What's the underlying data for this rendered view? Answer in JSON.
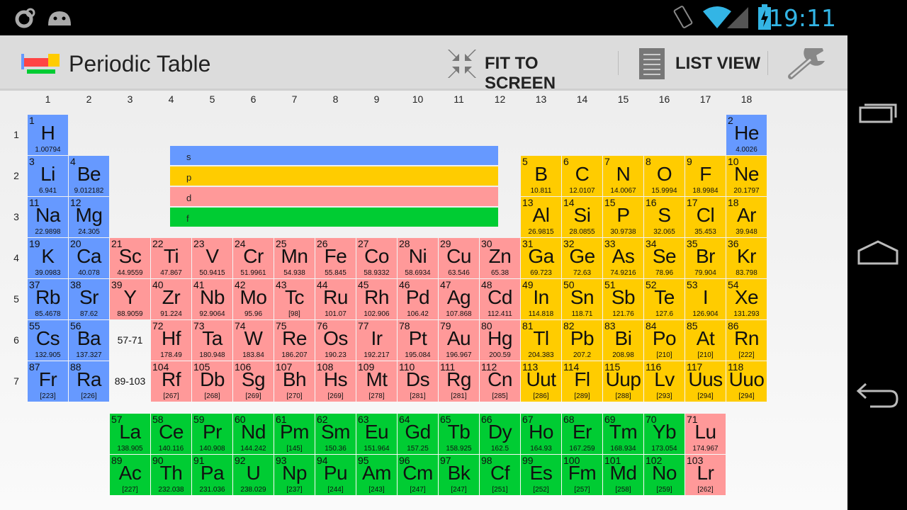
{
  "status_bar": {
    "time": "19:11",
    "icons": [
      "sync-icon",
      "android-icon",
      "vibrate-icon",
      "wifi-icon",
      "signal-icon",
      "battery-charging-icon"
    ]
  },
  "action_bar": {
    "title": "Periodic Table",
    "fit_label": "FIT TO SCREEN",
    "list_label": "LIST VIEW"
  },
  "colors": {
    "s": "#6699ff",
    "p": "#ffcc00",
    "d": "#ff9999",
    "f": "#00cc33"
  },
  "legend": [
    {
      "block": "s",
      "label": "s"
    },
    {
      "block": "p",
      "label": "p"
    },
    {
      "block": "d",
      "label": "d"
    },
    {
      "block": "f",
      "label": "f"
    }
  ],
  "groups": [
    "1",
    "2",
    "3",
    "4",
    "5",
    "6",
    "7",
    "8",
    "9",
    "10",
    "11",
    "12",
    "13",
    "14",
    "15",
    "16",
    "17",
    "18"
  ],
  "periods": [
    "1",
    "2",
    "3",
    "4",
    "5",
    "6",
    "7"
  ],
  "ranges": [
    "57-71",
    "89-103"
  ],
  "element_columns": [
    "number",
    "symbol",
    "weight",
    "block",
    "group",
    "period"
  ],
  "elements": [
    [
      1,
      "H",
      "1.00794",
      "s",
      1,
      1
    ],
    [
      2,
      "He",
      "4.0026",
      "s",
      18,
      1
    ],
    [
      3,
      "Li",
      "6.941",
      "s",
      1,
      2
    ],
    [
      4,
      "Be",
      "9.012182",
      "s",
      2,
      2
    ],
    [
      5,
      "B",
      "10.811",
      "p",
      13,
      2
    ],
    [
      6,
      "C",
      "12.0107",
      "p",
      14,
      2
    ],
    [
      7,
      "N",
      "14.0067",
      "p",
      15,
      2
    ],
    [
      8,
      "O",
      "15.9994",
      "p",
      16,
      2
    ],
    [
      9,
      "F",
      "18.9984",
      "p",
      17,
      2
    ],
    [
      10,
      "Ne",
      "20.1797",
      "p",
      18,
      2
    ],
    [
      11,
      "Na",
      "22.9898",
      "s",
      1,
      3
    ],
    [
      12,
      "Mg",
      "24.305",
      "s",
      2,
      3
    ],
    [
      13,
      "Al",
      "26.9815",
      "p",
      13,
      3
    ],
    [
      14,
      "Si",
      "28.0855",
      "p",
      14,
      3
    ],
    [
      15,
      "P",
      "30.9738",
      "p",
      15,
      3
    ],
    [
      16,
      "S",
      "32.065",
      "p",
      16,
      3
    ],
    [
      17,
      "Cl",
      "35.453",
      "p",
      17,
      3
    ],
    [
      18,
      "Ar",
      "39.948",
      "p",
      18,
      3
    ],
    [
      19,
      "K",
      "39.0983",
      "s",
      1,
      4
    ],
    [
      20,
      "Ca",
      "40.078",
      "s",
      2,
      4
    ],
    [
      21,
      "Sc",
      "44.9559",
      "d",
      3,
      4
    ],
    [
      22,
      "Ti",
      "47.867",
      "d",
      4,
      4
    ],
    [
      23,
      "V",
      "50.9415",
      "d",
      5,
      4
    ],
    [
      24,
      "Cr",
      "51.9961",
      "d",
      6,
      4
    ],
    [
      25,
      "Mn",
      "54.938",
      "d",
      7,
      4
    ],
    [
      26,
      "Fe",
      "55.845",
      "d",
      8,
      4
    ],
    [
      27,
      "Co",
      "58.9332",
      "d",
      9,
      4
    ],
    [
      28,
      "Ni",
      "58.6934",
      "d",
      10,
      4
    ],
    [
      29,
      "Cu",
      "63.546",
      "d",
      11,
      4
    ],
    [
      30,
      "Zn",
      "65.38",
      "d",
      12,
      4
    ],
    [
      31,
      "Ga",
      "69.723",
      "p",
      13,
      4
    ],
    [
      32,
      "Ge",
      "72.63",
      "p",
      14,
      4
    ],
    [
      33,
      "As",
      "74.9216",
      "p",
      15,
      4
    ],
    [
      34,
      "Se",
      "78.96",
      "p",
      16,
      4
    ],
    [
      35,
      "Br",
      "79.904",
      "p",
      17,
      4
    ],
    [
      36,
      "Kr",
      "83.798",
      "p",
      18,
      4
    ],
    [
      37,
      "Rb",
      "85.4678",
      "s",
      1,
      5
    ],
    [
      38,
      "Sr",
      "87.62",
      "s",
      2,
      5
    ],
    [
      39,
      "Y",
      "88.9059",
      "d",
      3,
      5
    ],
    [
      40,
      "Zr",
      "91.224",
      "d",
      4,
      5
    ],
    [
      41,
      "Nb",
      "92.9064",
      "d",
      5,
      5
    ],
    [
      42,
      "Mo",
      "95.96",
      "d",
      6,
      5
    ],
    [
      43,
      "Tc",
      "[98]",
      "d",
      7,
      5
    ],
    [
      44,
      "Ru",
      "101.07",
      "d",
      8,
      5
    ],
    [
      45,
      "Rh",
      "102.906",
      "d",
      9,
      5
    ],
    [
      46,
      "Pd",
      "106.42",
      "d",
      10,
      5
    ],
    [
      47,
      "Ag",
      "107.868",
      "d",
      11,
      5
    ],
    [
      48,
      "Cd",
      "112.411",
      "d",
      12,
      5
    ],
    [
      49,
      "In",
      "114.818",
      "p",
      13,
      5
    ],
    [
      50,
      "Sn",
      "118.71",
      "p",
      14,
      5
    ],
    [
      51,
      "Sb",
      "121.76",
      "p",
      15,
      5
    ],
    [
      52,
      "Te",
      "127.6",
      "p",
      16,
      5
    ],
    [
      53,
      "I",
      "126.904",
      "p",
      17,
      5
    ],
    [
      54,
      "Xe",
      "131.293",
      "p",
      18,
      5
    ],
    [
      55,
      "Cs",
      "132.905",
      "s",
      1,
      6
    ],
    [
      56,
      "Ba",
      "137.327",
      "s",
      2,
      6
    ],
    [
      72,
      "Hf",
      "178.49",
      "d",
      4,
      6
    ],
    [
      73,
      "Ta",
      "180.948",
      "d",
      5,
      6
    ],
    [
      74,
      "W",
      "183.84",
      "d",
      6,
      6
    ],
    [
      75,
      "Re",
      "186.207",
      "d",
      7,
      6
    ],
    [
      76,
      "Os",
      "190.23",
      "d",
      8,
      6
    ],
    [
      77,
      "Ir",
      "192.217",
      "d",
      9,
      6
    ],
    [
      78,
      "Pt",
      "195.084",
      "d",
      10,
      6
    ],
    [
      79,
      "Au",
      "196.967",
      "d",
      11,
      6
    ],
    [
      80,
      "Hg",
      "200.59",
      "d",
      12,
      6
    ],
    [
      81,
      "Tl",
      "204.383",
      "p",
      13,
      6
    ],
    [
      82,
      "Pb",
      "207.2",
      "p",
      14,
      6
    ],
    [
      83,
      "Bi",
      "208.98",
      "p",
      15,
      6
    ],
    [
      84,
      "Po",
      "[210]",
      "p",
      16,
      6
    ],
    [
      85,
      "At",
      "[210]",
      "p",
      17,
      6
    ],
    [
      86,
      "Rn",
      "[222]",
      "p",
      18,
      6
    ],
    [
      87,
      "Fr",
      "[223]",
      "s",
      1,
      7
    ],
    [
      88,
      "Ra",
      "[226]",
      "s",
      2,
      7
    ],
    [
      104,
      "Rf",
      "[267]",
      "d",
      4,
      7
    ],
    [
      105,
      "Db",
      "[268]",
      "d",
      5,
      7
    ],
    [
      106,
      "Sg",
      "[269]",
      "d",
      6,
      7
    ],
    [
      107,
      "Bh",
      "[270]",
      "d",
      7,
      7
    ],
    [
      108,
      "Hs",
      "[269]",
      "d",
      8,
      7
    ],
    [
      109,
      "Mt",
      "[278]",
      "d",
      9,
      7
    ],
    [
      110,
      "Ds",
      "[281]",
      "d",
      10,
      7
    ],
    [
      111,
      "Rg",
      "[281]",
      "d",
      11,
      7
    ],
    [
      112,
      "Cn",
      "[285]",
      "d",
      12,
      7
    ],
    [
      113,
      "Uut",
      "[286]",
      "p",
      13,
      7
    ],
    [
      114,
      "Fl",
      "[289]",
      "p",
      14,
      7
    ],
    [
      115,
      "Uup",
      "[288]",
      "p",
      15,
      7
    ],
    [
      116,
      "Lv",
      "[293]",
      "p",
      16,
      7
    ],
    [
      117,
      "Uus",
      "[294]",
      "p",
      17,
      7
    ],
    [
      118,
      "Uuo",
      "[294]",
      "p",
      18,
      7
    ]
  ],
  "lanthanides": [
    [
      57,
      "La",
      "138.905",
      "f"
    ],
    [
      58,
      "Ce",
      "140.116",
      "f"
    ],
    [
      59,
      "Pr",
      "140.908",
      "f"
    ],
    [
      60,
      "Nd",
      "144.242",
      "f"
    ],
    [
      61,
      "Pm",
      "[145]",
      "f"
    ],
    [
      62,
      "Sm",
      "150.36",
      "f"
    ],
    [
      63,
      "Eu",
      "151.964",
      "f"
    ],
    [
      64,
      "Gd",
      "157.25",
      "f"
    ],
    [
      65,
      "Tb",
      "158.925",
      "f"
    ],
    [
      66,
      "Dy",
      "162.5",
      "f"
    ],
    [
      67,
      "Ho",
      "164.93",
      "f"
    ],
    [
      68,
      "Er",
      "167.259",
      "f"
    ],
    [
      69,
      "Tm",
      "168.934",
      "f"
    ],
    [
      70,
      "Yb",
      "173.054",
      "f"
    ],
    [
      71,
      "Lu",
      "174.967",
      "d"
    ]
  ],
  "actinides": [
    [
      89,
      "Ac",
      "[227]",
      "f"
    ],
    [
      90,
      "Th",
      "232.038",
      "f"
    ],
    [
      91,
      "Pa",
      "231.036",
      "f"
    ],
    [
      92,
      "U",
      "238.029",
      "f"
    ],
    [
      93,
      "Np",
      "[237]",
      "f"
    ],
    [
      94,
      "Pu",
      "[244]",
      "f"
    ],
    [
      95,
      "Am",
      "[243]",
      "f"
    ],
    [
      96,
      "Cm",
      "[247]",
      "f"
    ],
    [
      97,
      "Bk",
      "[247]",
      "f"
    ],
    [
      98,
      "Cf",
      "[251]",
      "f"
    ],
    [
      99,
      "Es",
      "[252]",
      "f"
    ],
    [
      100,
      "Fm",
      "[257]",
      "f"
    ],
    [
      101,
      "Md",
      "[258]",
      "f"
    ],
    [
      102,
      "No",
      "[259]",
      "f"
    ],
    [
      103,
      "Lr",
      "[262]",
      "d"
    ]
  ]
}
